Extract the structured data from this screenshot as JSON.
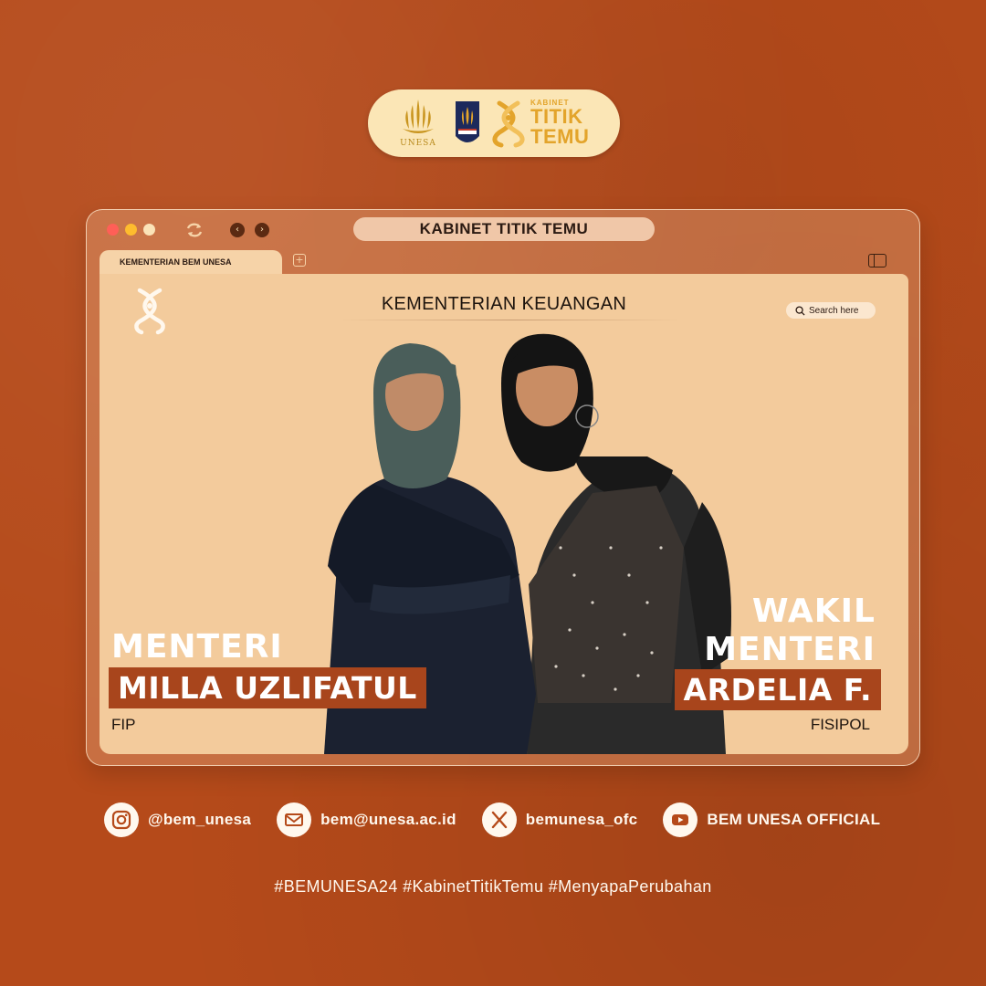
{
  "logos": {
    "unesa_text": "UNESA",
    "kabinet_label": "KABINET",
    "kabinet_name_line1": "TITIK",
    "kabinet_name_line2": "TEMU"
  },
  "browser": {
    "address": "KABINET TITIK TEMU",
    "tab_label": "KEMENTERIAN BEM UNESA"
  },
  "page": {
    "heading": "KEMENTERIAN KEUANGAN",
    "search_placeholder": "Search here"
  },
  "left_person": {
    "role": "MENTERI",
    "name": "MILLA UZLIFATUL",
    "faculty": "FIP"
  },
  "right_person": {
    "role_line1": "WAKIL",
    "role_line2": "MENTERI",
    "name": "ARDELIA F.",
    "faculty": "FISIPOL"
  },
  "socials": {
    "instagram": "@bem_unesa",
    "email": "bem@unesa.ac.id",
    "x": "bemunesa_ofc",
    "youtube": "BEM UNESA OFFICIAL"
  },
  "hashtags": "#BEMUNESA24 #KabinetTitikTemu #MenyapaPerubahan",
  "colors": {
    "background": "#b54a1a",
    "accent": "#a8451c",
    "content_bg": "#f3cb9c",
    "gold": "#e3a42b"
  }
}
